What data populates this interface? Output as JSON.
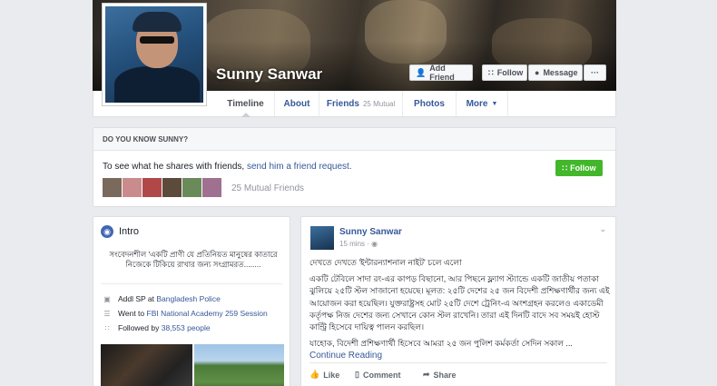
{
  "profile": {
    "name": "Sunny Sanwar",
    "buttons": {
      "add_friend": "Add Friend",
      "follow": "Follow",
      "message": "Message",
      "more": "···"
    }
  },
  "tabs": [
    {
      "label": "Timeline"
    },
    {
      "label": "About"
    },
    {
      "label": "Friends",
      "sub": "25 Mutual"
    },
    {
      "label": "Photos"
    },
    {
      "label": "More"
    }
  ],
  "know_box": {
    "title": "DO YOU KNOW SUNNY?",
    "text": "To see what he shares with friends,",
    "link": "send him a friend request.",
    "follow_label": "Follow",
    "mutual": "25 Mutual Friends"
  },
  "intro": {
    "title": "Intro",
    "bio": "সংবেদনশীল 'একটি প্রাণী যে প্রতিনিয়ত মানুষের কাতারে নিজেকে টিকিয়ে রাখার জন্য সংগ্রামরত........",
    "rows": [
      {
        "prefix": "Addl SP at",
        "link": "Bangladesh Police"
      },
      {
        "prefix": "Went to",
        "link": "FBI National Academy 259 Session"
      },
      {
        "prefix": "Followed by",
        "link": "38,553 people"
      }
    ]
  },
  "post": {
    "author": "Sunny Sanwar",
    "time": "15 mins",
    "paragraphs": [
      "দেখতে দেখতে 'ইন্টারন্যাশনাল নাইট' চলে এলো",
      "একটি টেবিলে সাদা রং-এর কাপড় বিছানো, আর পিছনে ফ্ল্যাগ স্ট্যান্ডে একটি জাতীয় পতাকা ঝুলিয়ে ২৫টি স্টল সাজানো হয়েছে। মূলত: ২৫টি দেশের ২৫ জন বিদেশী প্রশিক্ষণার্থীর জন্য এই আয়োজন করা হয়েছিল। যুক্তরাষ্ট্রসহ মোট ২৫টি দেশে ট্রেনিং-এ অংশগ্রহন করলেও একাডেমী কর্তৃপক্ষ নিজ দেশের জন্য সেখানে কোন স্টল রাখেনি। তারা এই দিনটি বাদে সব সময়ই হোস্ট কান্ট্রি হিসেবে দায়িত্ব পালন করছিল।",
      "যাহোক, বিদেশী প্রশিক্ষণার্থী হিসেবে আমরা ২৫ জন পুলিশ কর্মকর্তা সেদিন সকাল ..."
    ],
    "continue": "Continue Reading",
    "actions": {
      "like": "Like",
      "comment": "Comment",
      "share": "Share"
    }
  }
}
